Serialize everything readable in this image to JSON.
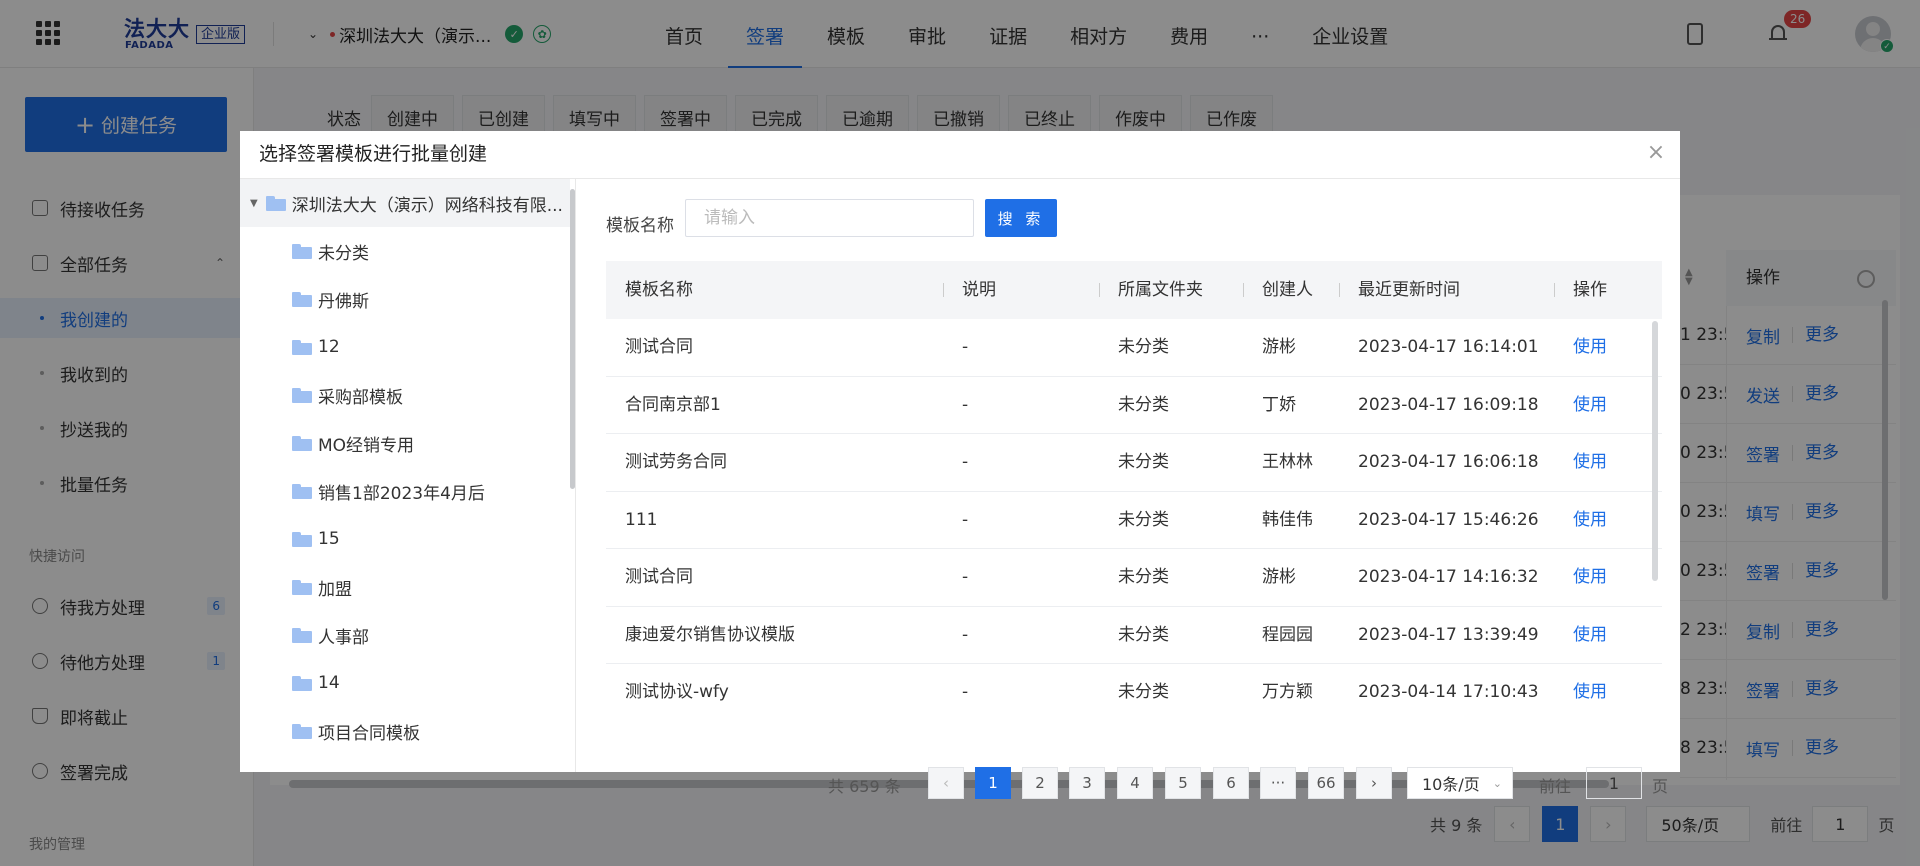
{
  "topbar": {
    "logo_cn": "法大大",
    "logo_en": "FADADA",
    "logo_badge": "企业版",
    "org_name": "深圳法大大（演示...",
    "nav": [
      "首页",
      "签署",
      "模板",
      "审批",
      "证据",
      "相对方",
      "费用",
      "···",
      "企业设置"
    ],
    "active_nav": "签署",
    "notification_count": "26"
  },
  "sidebar": {
    "create_button": "创建任务",
    "items": [
      {
        "label": "待接收任务",
        "icon": "inbox-icon"
      },
      {
        "label": "全部任务",
        "icon": "doc-icon"
      },
      {
        "label": "我创建的"
      },
      {
        "label": "我收到的"
      },
      {
        "label": "抄送我的"
      },
      {
        "label": "批量任务"
      }
    ],
    "quick_section": "快捷访问",
    "quick_items": [
      {
        "label": "待我方处理",
        "count": "6"
      },
      {
        "label": "待他方处理",
        "count": "1"
      },
      {
        "label": "即将截止"
      },
      {
        "label": "签署完成"
      }
    ],
    "manage_section": "我的管理"
  },
  "background": {
    "filter_label": "状态",
    "filters": [
      "创建中",
      "已创建",
      "填写中",
      "签署中",
      "已完成",
      "已逾期",
      "已撤销",
      "已终止",
      "作废中",
      "已作废"
    ],
    "ops_header": "操作",
    "rows": [
      {
        "time": "1 23:5",
        "a": "复制",
        "b": "更多"
      },
      {
        "time": "0 23:5",
        "a": "发送",
        "b": "更多"
      },
      {
        "time": "0 23:5",
        "a": "签署",
        "b": "更多"
      },
      {
        "time": "0 23:5",
        "a": "填写",
        "b": "更多"
      },
      {
        "time": "0 23:5",
        "a": "签署",
        "b": "更多"
      },
      {
        "time": "2 23:5",
        "a": "复制",
        "b": "更多"
      },
      {
        "time": "8 23:5",
        "a": "签署",
        "b": "更多"
      },
      {
        "time": "8 23:5",
        "a": "填写",
        "b": "更多"
      }
    ],
    "pager": {
      "total": "共 9 条",
      "page": "1",
      "size": "50条/页",
      "goto": "前往",
      "goto_value": "1",
      "unit": "页"
    }
  },
  "modal": {
    "title": "选择签署模板进行批量创建",
    "tree": {
      "root": "深圳法大大（演示）网络科技有限...",
      "folders": [
        "未分类",
        "丹佛斯",
        "12",
        "采购部模板",
        "MO经销专用",
        "销售1部2023年4月后",
        "15",
        "加盟",
        "人事部",
        "14",
        "项目合同模板"
      ]
    },
    "search": {
      "label": "模板名称",
      "placeholder": "请输入",
      "button": "搜 索"
    },
    "columns": [
      "模板名称",
      "说明",
      "所属文件夹",
      "创建人",
      "最近更新时间",
      "操作"
    ],
    "rows": [
      {
        "name": "测试合同",
        "desc": "-",
        "folder": "未分类",
        "creator": "游彬",
        "updated": "2023-04-17 16:14:01",
        "action": "使用"
      },
      {
        "name": "合同南京部1",
        "desc": "-",
        "folder": "未分类",
        "creator": "丁娇",
        "updated": "2023-04-17 16:09:18",
        "action": "使用"
      },
      {
        "name": "测试劳务合同",
        "desc": "-",
        "folder": "未分类",
        "creator": "王林林",
        "updated": "2023-04-17 16:06:18",
        "action": "使用"
      },
      {
        "name": "111",
        "desc": "-",
        "folder": "未分类",
        "creator": "韩佳伟",
        "updated": "2023-04-17 15:46:26",
        "action": "使用"
      },
      {
        "name": "测试合同",
        "desc": "-",
        "folder": "未分类",
        "creator": "游彬",
        "updated": "2023-04-17 14:16:32",
        "action": "使用"
      },
      {
        "name": "康迪爱尔销售协议模版",
        "desc": "-",
        "folder": "未分类",
        "creator": "程园园",
        "updated": "2023-04-17 13:39:49",
        "action": "使用"
      },
      {
        "name": "测试协议-wfy",
        "desc": "-",
        "folder": "未分类",
        "creator": "万方颖",
        "updated": "2023-04-14 17:10:43",
        "action": "使用"
      }
    ],
    "pager": {
      "total": "共 659 条",
      "pages": [
        "1",
        "2",
        "3",
        "4",
        "5",
        "6",
        "···",
        "66"
      ],
      "current": "1",
      "size": "10条/页",
      "goto": "前往",
      "goto_value": "1",
      "unit": "页"
    }
  },
  "colors": {
    "accent": "#1f6fe6",
    "brand": "#1f3d99",
    "danger": "#e54545",
    "success": "#26a66b"
  }
}
